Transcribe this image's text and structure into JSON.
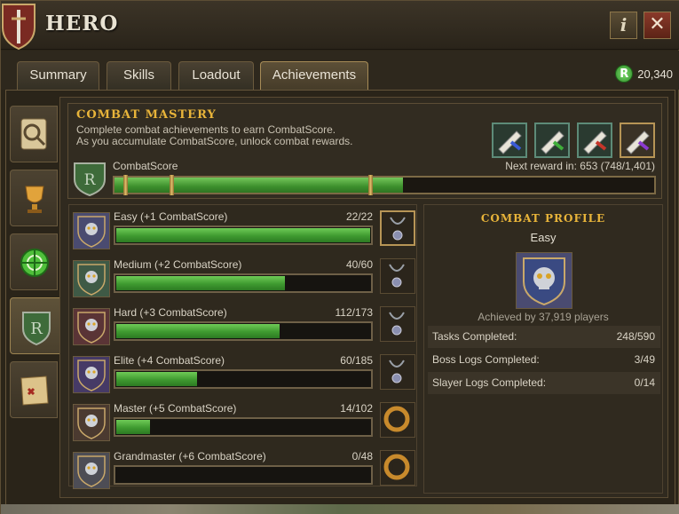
{
  "window": {
    "title": "HERO"
  },
  "header": {
    "info_label": "i",
    "close_label": "✕"
  },
  "tabs": [
    {
      "label": "Summary"
    },
    {
      "label": "Skills"
    },
    {
      "label": "Loadout"
    },
    {
      "label": "Achievements",
      "active": true
    }
  ],
  "currency": {
    "icon": "R",
    "amount": "20,340"
  },
  "side_tabs": [
    {
      "icon": "magnifier-scroll-icon"
    },
    {
      "icon": "trophy-icon"
    },
    {
      "icon": "green-compass-icon"
    },
    {
      "icon": "combat-shield-icon",
      "active": true
    },
    {
      "icon": "treasure-map-icon"
    }
  ],
  "mastery": {
    "title": "COMBAT MASTERY",
    "desc_line1": "Complete combat achievements to earn CombatScore.",
    "desc_line2": "As you accumulate CombatScore, unlock combat rewards.",
    "score_label": "CombatScore",
    "next_reward": "Next reward in: 653 (748/1,401)",
    "current": 748,
    "max": 1401,
    "reward_scrolls": [
      "blue",
      "green",
      "red",
      "purple"
    ]
  },
  "tiers": [
    {
      "name": "Easy (+1 CombatScore)",
      "count": "22/22",
      "done": 22,
      "total": 22,
      "color": "#4a4b70",
      "reward": "amulet",
      "unlocked": true
    },
    {
      "name": "Medium (+2 CombatScore)",
      "count": "40/60",
      "done": 40,
      "total": 60,
      "color": "#3f5a46",
      "reward": "amulet",
      "unlocked": false
    },
    {
      "name": "Hard (+3 CombatScore)",
      "count": "112/173",
      "done": 112,
      "total": 173,
      "color": "#5a3436",
      "reward": "amulet",
      "unlocked": false
    },
    {
      "name": "Elite (+4 CombatScore)",
      "count": "60/185",
      "done": 60,
      "total": 185,
      "color": "#463a66",
      "reward": "amulet",
      "unlocked": false
    },
    {
      "name": "Master (+5 CombatScore)",
      "count": "14/102",
      "done": 14,
      "total": 102,
      "color": "#4b3a30",
      "reward": "ring",
      "unlocked": false
    },
    {
      "name": "Grandmaster (+6 CombatScore)",
      "count": "0/48",
      "done": 0,
      "total": 48,
      "color": "#4d4d55",
      "reward": "ring",
      "unlocked": false
    }
  ],
  "profile": {
    "title": "COMBAT PROFILE",
    "tier": "Easy",
    "achieved": "Achieved by 37,919 players",
    "stats": [
      {
        "label": "Tasks Completed:",
        "value": "248/590"
      },
      {
        "label": "Boss Logs Completed:",
        "value": "3/49"
      },
      {
        "label": "Slayer Logs Completed:",
        "value": "0/14"
      }
    ]
  }
}
